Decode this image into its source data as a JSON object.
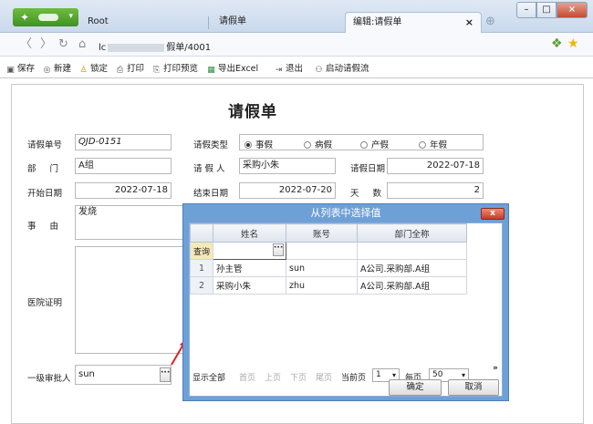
{
  "browser": {
    "tabs": [
      {
        "label": "Root"
      },
      {
        "label": "请假单"
      },
      {
        "label": "编辑:请假单",
        "close": "×"
      }
    ],
    "new_tab": "⊕",
    "url_prefix": "lc",
    "url_suffix": "假单/4001",
    "window_controls": {
      "min": "–",
      "max": "□",
      "close": "×"
    }
  },
  "toolbar": {
    "items": [
      {
        "label": "保存",
        "icon": "save-icon"
      },
      {
        "label": "新建",
        "icon": "new-icon"
      },
      {
        "label": "锁定",
        "icon": "lock-icon"
      },
      {
        "label": "打印",
        "icon": "print-icon"
      },
      {
        "label": "打印预览",
        "icon": "preview-icon"
      },
      {
        "label": "导出Excel",
        "icon": "excel-icon"
      },
      {
        "label": "退出",
        "icon": "exit-icon"
      },
      {
        "label": "启动请假流",
        "icon": "flow-icon"
      }
    ]
  },
  "form": {
    "title": "请假单",
    "order_no_label": "请假单号",
    "order_no": "QJD-0151",
    "leave_type_label": "请假类型",
    "leave_types": [
      {
        "label": "事假",
        "checked": true
      },
      {
        "label": "病假",
        "checked": false
      },
      {
        "label": "产假",
        "checked": false
      },
      {
        "label": "年假",
        "checked": false
      }
    ],
    "dept_label": "部 门",
    "dept": "A组",
    "applicant_label": "请 假 人",
    "applicant": "采购小朱",
    "apply_date_label": "请假日期",
    "apply_date": "2022-07-18",
    "start_label": "开始日期",
    "start": "2022-07-18",
    "end_label": "结束日期",
    "end": "2022-07-20",
    "days_label": "天 数",
    "days": "2",
    "reason_label": "事 由",
    "reason": "发烧",
    "cert_label": "医院证明",
    "approver_label": "一级审批人",
    "approver": "sun",
    "picker_btn": "···"
  },
  "dialog": {
    "title": "从列表中选择值",
    "close": "x",
    "columns": [
      "姓名",
      "账号",
      "部门全称"
    ],
    "query_label": "查询",
    "rows": [
      {
        "no": "1",
        "name": "孙主管",
        "account": "sun",
        "dept": "A公司.采购部.A组"
      },
      {
        "no": "2",
        "name": "采购小朱",
        "account": "zhu",
        "dept": "A公司.采购部.A组"
      }
    ],
    "pager": {
      "show_all": "显示全部",
      "first": "首页",
      "prev": "上页",
      "next": "下页",
      "last": "尾页",
      "current_label": "当前页",
      "current": "1",
      "per_page_label": "每页",
      "per_page": "50",
      "more": "»"
    },
    "ok": "确定",
    "cancel": "取消"
  }
}
